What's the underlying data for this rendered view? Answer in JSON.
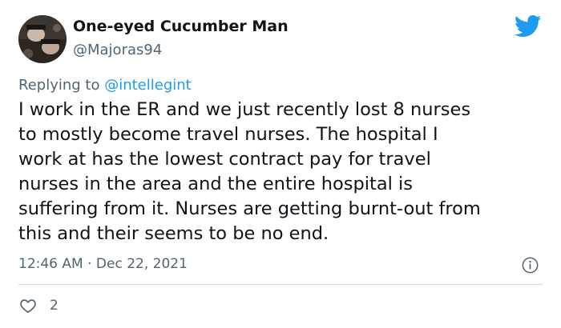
{
  "author": {
    "name": "One-eyed Cucumber Man",
    "handle": "@Majoras94"
  },
  "reply": {
    "prefix": "Replying to ",
    "handle": "@intellegint"
  },
  "tweet": {
    "text": "I work in the ER and we just recently lost 8 nurses\nto mostly become travel nurses. The hospital I\nwork at has the lowest contract pay for travel\nnurses in the area and the entire hospital is\nsuffering from it. Nurses are getting burnt-out from\nthis and their seems to be no end.",
    "timestamp": "12:46 AM · Dec 22, 2021",
    "likes": "2"
  },
  "icons": {
    "brand": "twitter-bird-icon",
    "info": "info-icon",
    "like": "heart-icon"
  },
  "colors": {
    "brand": "#1d9bf0",
    "text": "#0f1419",
    "muted": "#536471",
    "divider": "#cfd9de"
  }
}
